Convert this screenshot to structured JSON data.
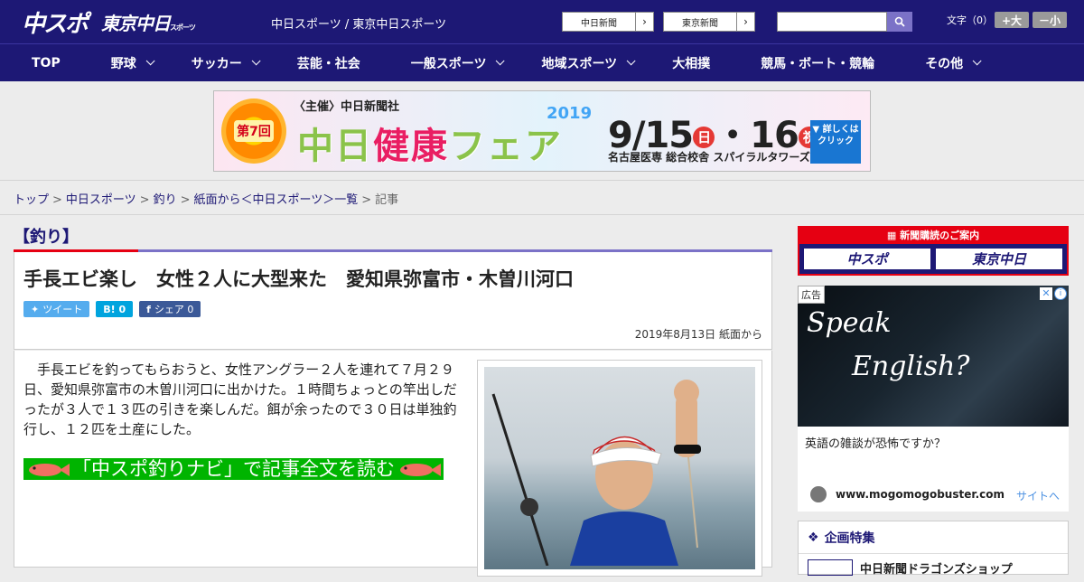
{
  "header": {
    "logo_main": "中スポ",
    "logo_tokyo": "東京中日",
    "logo_tokyo_sub": "スポーツ",
    "site_links": "中日スポーツ / 東京中日スポーツ",
    "btn_chunichi": "中日新聞",
    "btn_tokyo": "東京新聞",
    "search_placeholder": "",
    "fontsize_label": "文字（0）",
    "fontsize_big": "+大",
    "fontsize_small": "－小"
  },
  "nav": [
    {
      "label": "TOP",
      "dropdown": false
    },
    {
      "label": "野球",
      "dropdown": true
    },
    {
      "label": "サッカー",
      "dropdown": true
    },
    {
      "label": "芸能・社会",
      "dropdown": false
    },
    {
      "label": "一般スポーツ",
      "dropdown": true
    },
    {
      "label": "地域スポーツ",
      "dropdown": true
    },
    {
      "label": "大相撲",
      "dropdown": false
    },
    {
      "label": "競馬・ボート・競輪",
      "dropdown": false
    },
    {
      "label": "その他",
      "dropdown": true
    }
  ],
  "banner": {
    "badge": "第7回",
    "org": "〈主催〉中日新聞社",
    "title_a": "中日",
    "title_b": "健康",
    "title_c": "フェア",
    "year": "2019",
    "date_a": "9/15",
    "day_a": "日",
    "date_b": "・16",
    "day_b": "祝",
    "venue": "名古屋医専 総合校舎 スパイラルタワーズ",
    "click": "▼ 詳しくは クリック"
  },
  "breadcrumb": [
    "トップ",
    "中日スポーツ",
    "釣り",
    "紙面から＜中日スポーツ＞一覧",
    "記事"
  ],
  "article": {
    "category": "【釣り】",
    "title": "手長エビ楽し　女性２人に大型来た　愛知県弥富市・木曽川河口",
    "share_tweet": "ツイート",
    "share_hatena": "B! 0",
    "share_fb": "シェア 0",
    "date": "2019年8月13日 紙面から",
    "body": "手長エビを釣ってもらおうと、女性アングラー２人を連れて７月２９日、愛知県弥富市の木曽川河口に出かけた。１時間ちょっとの竿出しだったが３人で１３匹の引きを楽しんだ。餌が余ったので３０日は単独釣行し、１２匹を土産にした。",
    "navi_link": "「中スポ釣りナビ」で記事全文を読む"
  },
  "sidebar": {
    "subscribe_head": "新聞購読のご案内",
    "subscribe_a": "中スポ",
    "subscribe_b": "東京中日",
    "ad_tag": "広告",
    "ad_img_text_a": "Speak",
    "ad_img_text_b": "English?",
    "ad_text": "英語の雑談が恐怖ですか？",
    "ad_domain": "www.mogomogobuster.com",
    "ad_site": "サイトへ",
    "feature_head": "企画特集",
    "feature_item": "中日新聞ドラゴンズショップ"
  },
  "colors": {
    "brand_navy": "#1d1875",
    "accent_red": "#e60012",
    "accent_purple": "#7b72c7",
    "navi_green": "#00b400"
  }
}
